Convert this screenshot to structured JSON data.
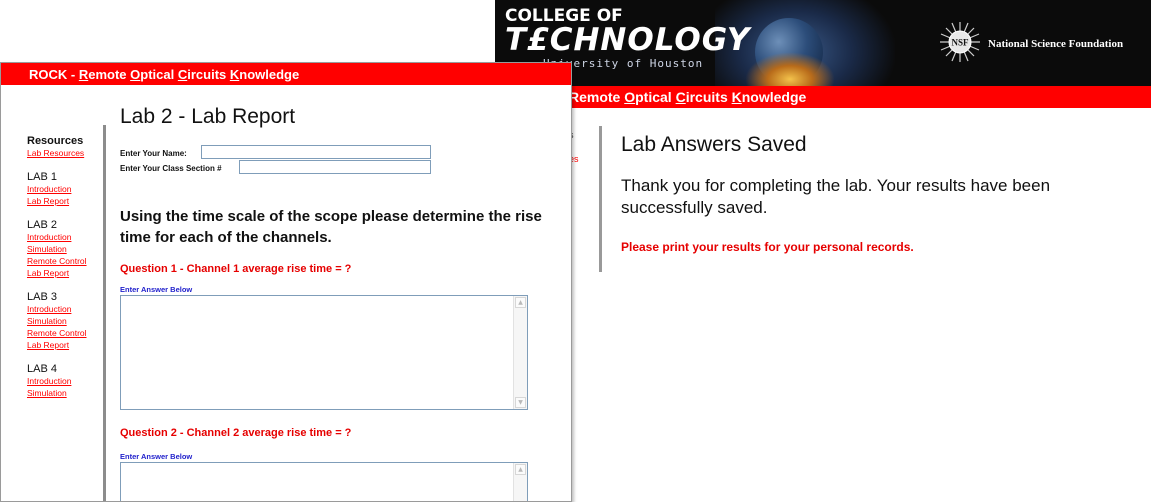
{
  "back_window": {
    "banner": {
      "college": "COLLEGE OF",
      "technology": "T£CHNOLOGY",
      "university": "University of Houston",
      "nsf_logo_text": "NSF",
      "nsf_label": "National Science Foundation"
    },
    "header_prefix": "Remote ",
    "header_o": "O",
    "header_ptical": "ptical ",
    "header_c": "C",
    "header_ircuits": "ircuits ",
    "header_k": "K",
    "header_nowledge": "nowledge",
    "sidebar_fragment_1": "s",
    "sidebar_fragment_2": "es",
    "title": "Lab Answers Saved",
    "thanks": "Thank you for completing the lab. Your results have been successfully saved.",
    "print_notice": "Please print your results for your personal records."
  },
  "front_window": {
    "header_rock": "ROCK - ",
    "header_r": "R",
    "header_emote": "emote ",
    "header_o": "O",
    "header_ptical": "ptical ",
    "header_c": "C",
    "header_ircuits": "ircuits ",
    "header_k": "K",
    "header_nowledge": "nowledge",
    "sidebar": {
      "resources_heading": "Resources",
      "resources_link": "Lab Resources",
      "labs": [
        {
          "title": "LAB 1",
          "links": [
            "Introduction",
            "Lab Report"
          ]
        },
        {
          "title": "LAB 2",
          "links": [
            "Introduction",
            "Simulation",
            "Remote Control",
            "Lab Report"
          ]
        },
        {
          "title": "LAB 3",
          "links": [
            "Introduction",
            "Simulation",
            "Remote Control",
            "Lab Report"
          ]
        },
        {
          "title": "LAB 4",
          "links": [
            "Introduction",
            "Simulation"
          ]
        }
      ]
    },
    "page_title": "Lab 2 - Lab Report",
    "name_label": "Enter Your Name:",
    "name_value": "",
    "section_label": "Enter Your Class Section #",
    "section_value": "",
    "intro": "Using the time scale of the scope please determine the rise time for each of the channels.",
    "questions": [
      {
        "text": "Question 1 - Channel 1 average rise time = ?",
        "answer_label": "Enter Answer Below",
        "answer": ""
      },
      {
        "text": "Question 2 - Channel 2 average rise time = ?",
        "answer_label": "Enter Answer Below",
        "answer": ""
      }
    ]
  },
  "colors": {
    "header_red": "#ff0000",
    "question_red": "#e60000",
    "answer_label_blue": "#2222cc",
    "banner_black": "#0b0b0b"
  },
  "icons": [
    "nsf-logo-icon",
    "scroll-up-arrow-icon",
    "scroll-down-arrow-icon"
  ]
}
